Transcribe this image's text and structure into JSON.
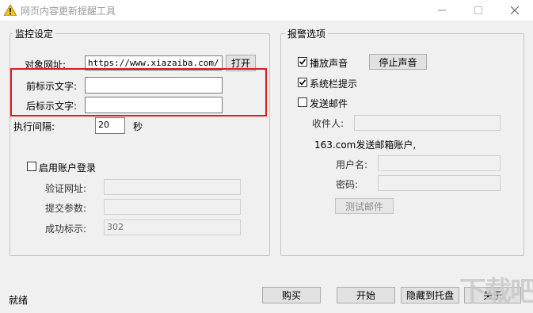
{
  "window": {
    "title": "网页内容更新提醒工具",
    "min_icon": "minimize-icon",
    "max_icon": "maximize-icon",
    "close_icon": "close-icon"
  },
  "monitor": {
    "group_label": "监控设定",
    "target_url_label": "对象网址:",
    "target_url_value": "https://www.xiazaiba.com/",
    "open_button": "打开",
    "prefix_label": "前标示文字:",
    "prefix_value": "",
    "suffix_label": "后标示文字:",
    "suffix_value": "",
    "interval_label": "执行间隔:",
    "interval_value": "20",
    "interval_unit": "秒",
    "account_login_label": "启用账户登录",
    "verify_url_label": "验证网址:",
    "verify_url_value": "",
    "submit_params_label": "提交参数:",
    "submit_params_value": "",
    "success_label": "成功标示:",
    "success_value": "302"
  },
  "alarm": {
    "group_label": "报警选项",
    "play_sound_label": "播放声音",
    "play_sound_checked": true,
    "stop_sound_button": "停止声音",
    "tray_tip_label": "系统栏提示",
    "tray_tip_checked": true,
    "send_mail_label": "发送邮件",
    "send_mail_checked": false,
    "recipient_label": "收件人:",
    "sender_account_label": "163.com发送邮箱账户,",
    "username_label": "用户名:",
    "password_label": "密码:",
    "test_mail_button": "测试邮件"
  },
  "footer": {
    "status": "就绪",
    "buy_button": "购买",
    "start_button": "开始",
    "hide_tray_button": "隐藏到托盘",
    "about_button": "关于"
  },
  "watermark": "下载吧",
  "colors": {
    "highlight": "#e01b1b",
    "window_bg": "#f0f0f0"
  }
}
